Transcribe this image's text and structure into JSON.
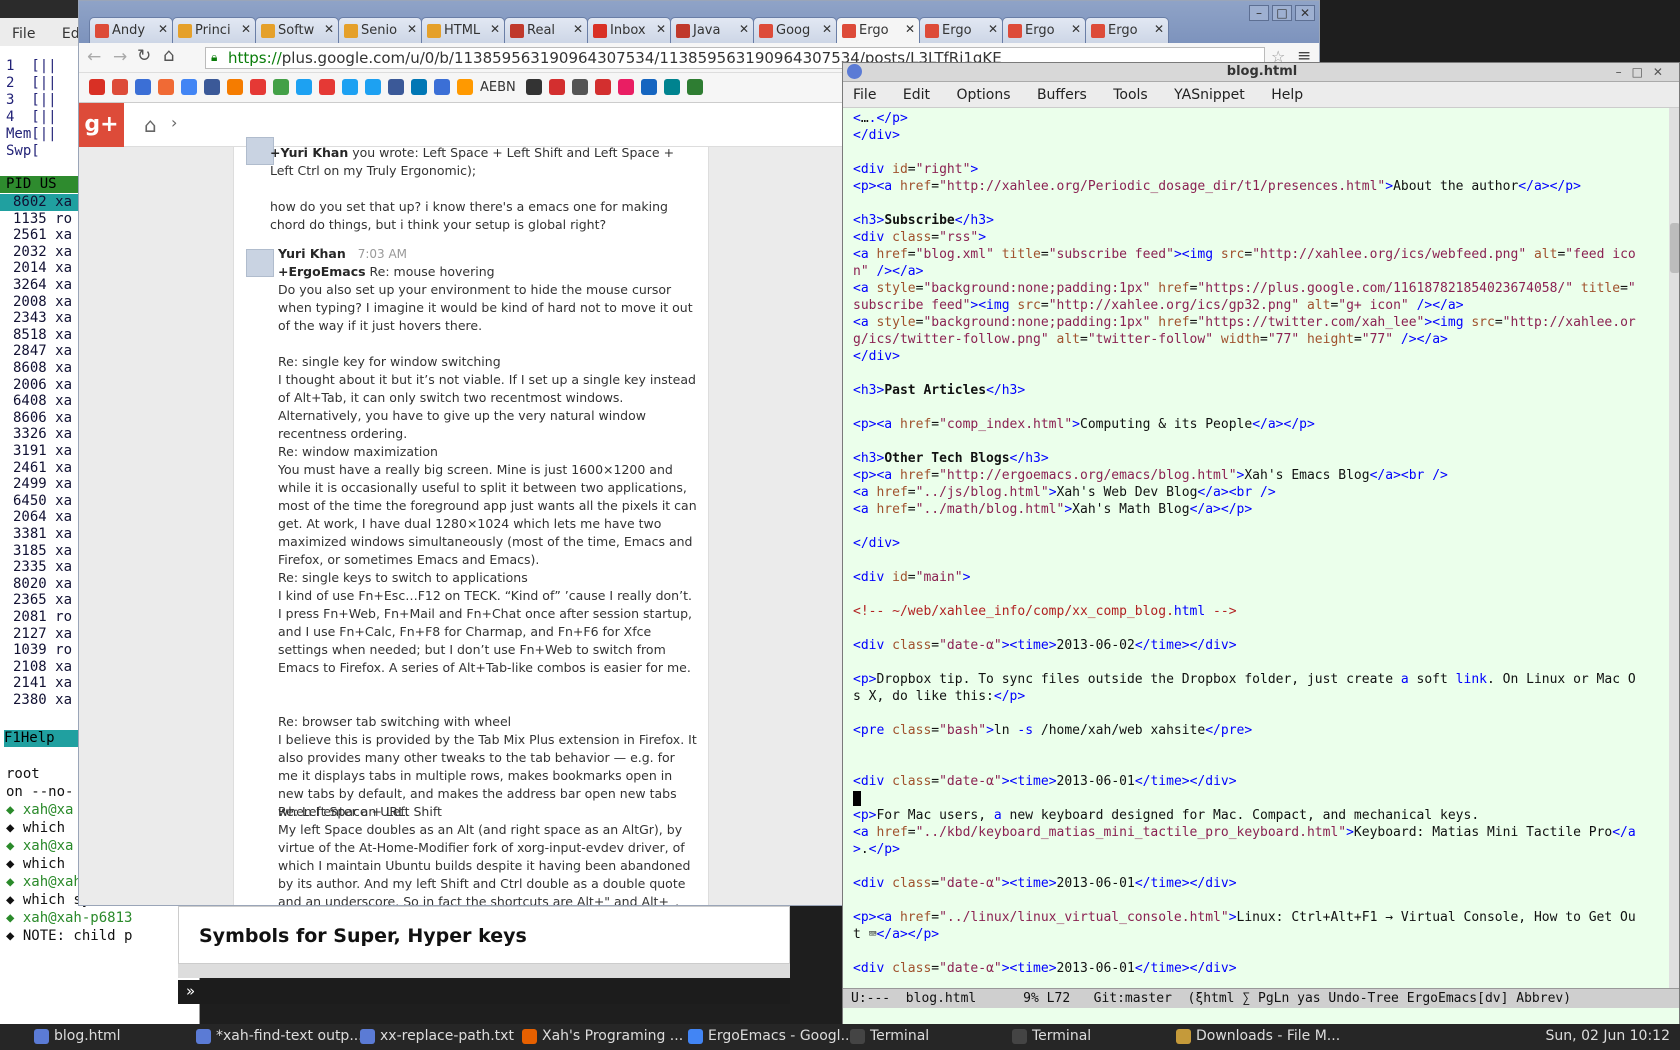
{
  "terminal": {
    "menu": [
      "File",
      "Edit"
    ],
    "htop_header": [
      "1  [||",
      "2  [||",
      "3  [||",
      "4  [||",
      "Mem[||",
      "Swp["
    ],
    "pid_header": "PID US",
    "rows": [
      "8602 xa",
      "1135 ro",
      "2561 xa",
      "2032 xa",
      "2014 xa",
      "3264 xa",
      "2008 xa",
      "2343 xa",
      "8518 xa",
      "2847 xa",
      "8608 xa",
      "2006 xa",
      "6408 xa",
      "8606 xa",
      "3326 xa",
      "3191 xa",
      "2461 xa",
      "2499 xa",
      "6450 xa",
      "2064 xa",
      "3381 xa",
      "3185 xa",
      "2335 xa",
      "8020 xa",
      "2365 xa",
      "2081 ro",
      "2127 xa",
      "1039 ro",
      "2108 xa",
      "2141 xa",
      "2380 xa"
    ],
    "f1": "F1Help",
    "lower": [
      "root",
      "on --no-",
      "◆ xah@xa",
      "◆ which",
      "◆ xah@xa",
      "◆ which",
      "◆ xah@xah-p6813",
      "◆ which systemd",
      "◆ xah@xah-p6813",
      "◆ NOTE: child p"
    ]
  },
  "chrome": {
    "tabs": [
      {
        "label": "Andy",
        "color": "#dd4b39"
      },
      {
        "label": "Princi",
        "color": "#e5a02a"
      },
      {
        "label": "Softw",
        "color": "#e5a02a"
      },
      {
        "label": "Senio",
        "color": "#e5a02a"
      },
      {
        "label": "HTML",
        "color": "#e5a02a"
      },
      {
        "label": "Real",
        "color": "#c0392b"
      },
      {
        "label": "Inbox",
        "color": "#d93025"
      },
      {
        "label": "Java",
        "color": "#c0392b"
      },
      {
        "label": "Goog",
        "color": "#dd4b39"
      },
      {
        "label": "Ergo",
        "color": "#dd4b39"
      },
      {
        "label": "Ergo",
        "color": "#dd4b39"
      },
      {
        "label": "Ergo",
        "color": "#dd4b39"
      },
      {
        "label": "Ergo",
        "color": "#dd4b39"
      }
    ],
    "url_scheme": "https://",
    "url_rest": "plus.google.com/u/0/b/113859563190964307534/113859563190964307534/posts/L3LTfRj1qKE",
    "bookmark_label": "AEBN",
    "bookmark_colors": [
      "#d93025",
      "#dd4b39",
      "#3b6fd6",
      "#f06a35",
      "#4285f4",
      "#3b5998",
      "#f57c00",
      "#e53935",
      "#43a047",
      "#1da1f2",
      "#e53935",
      "#1da1f2",
      "#1da1f2",
      "#3b5998",
      "#0077b5",
      "#3b6fd6",
      "#ff9900",
      "#333333",
      "#d32f2f",
      "#555555",
      "#d32f2f",
      "#e91e63",
      "#1565c0",
      "#00838f",
      "#2e7d32"
    ],
    "gplus_logo": "g+",
    "comment1_name": "+Yuri Khan",
    "comment1_text": " you wrote: Left Space + Left Shift and Left Space + Left Ctrl on my Truly Ergonomic);",
    "comment1_q": "how do you set that up? i know there's a emacs one for making chord do things, but i think your setup is global right?",
    "comment2_name": "Yuri Khan",
    "comment2_time": "7:03 AM",
    "comment2_to": "+ErgoEmacs",
    "comment2_re": " Re: mouse hovering",
    "p1": "Do you also set up your environment to hide the mouse cursor when typing? I imagine it would be kind of hard not to move it out of the way if it just hovers there.",
    "p2h": "Re: single key for window switching",
    "p2": "I thought about it but it’s not viable. If I set up a single key instead of Alt+Tab, it can only switch two recentmost windows. Alternatively, you have to give up the very natural window recentness ordering.",
    "p3h": "Re: window maximization",
    "p3": "You must have a really big screen. Mine is just 1600×1200 and while it is occasionally useful to split it between two applications, most of the time the foreground app just wants all the pixels it can get. At work, I have dual 1280×1024 which lets me have two maximized windows simultaneously (most of the time, Emacs and Firefox, or sometimes Emacs and Emacs).",
    "p4h": "Re: single keys to switch to applications",
    "p4": "I kind of use Fn+Esc…F12 on TECK. “Kind of” ’cause I really don’t. I press Fn+Web, Fn+Mail and Fn+Chat once after session startup, and I use Fn+Calc, Fn+F8 for Charmap, and Fn+F6 for Xfce settings when needed; but I don’t use Fn+Web to switch from Emacs to Firefox. A series of Alt+Tab-like combos is easier for me.",
    "p5h": "Re: browser tab switching with wheel",
    "p5": "I believe this is provided by the Tab Mix Plus extension in Firefox. It also provides many other tweaks to the tab behavior — e.g. for me it displays tabs in multiple rows, makes bookmarks open in new tabs by default, and makes the address bar open new tabs when I enter an URL.",
    "p6h": "Re: Left Space + Left Shift",
    "p6": "My left Space doubles as an Alt (and right space as an AltGr), by virtue of the At-Home-Modifier fork of xorg-input-evdev driver, of which I maintain Ubuntu builds despite it having been abandoned by its author. And my left Shift and Ctrl double as a double quote and an underscore. So in fact the shortcuts are Alt+\" and Alt+_. And my window manager is Compiz which allows almost all"
  },
  "notif": {
    "title": "Symbols for Super, Hyper keys",
    "prompt": "»"
  },
  "emacs": {
    "title": "blog.html",
    "menu": [
      "File",
      "Edit",
      "Options",
      "Buffers",
      "Tools",
      "YASnippet",
      "Help"
    ],
    "modeline": "U:---  blog.html      9% L72   Git:master  (ξhtml ∑ PgLn yas Undo-Tree ErgoEmacs[dv] Abbrev)"
  },
  "taskbar": {
    "items": [
      {
        "label": "blog.html",
        "color": "#5b7bd5"
      },
      {
        "label": "*xah-find-text outp...",
        "color": "#5b7bd5"
      },
      {
        "label": "xx-replace-path.txt",
        "color": "#5b7bd5"
      },
      {
        "label": "Xah's Programing ...",
        "color": "#e66000"
      },
      {
        "label": "ErgoEmacs - Googl...",
        "color": "#4285f4"
      },
      {
        "label": "Terminal",
        "color": "#444444"
      },
      {
        "label": "Terminal",
        "color": "#444444"
      },
      {
        "label": "Downloads - File M...",
        "color": "#c59a3a"
      }
    ],
    "clock": "Sun, 02 Jun  10:12"
  }
}
